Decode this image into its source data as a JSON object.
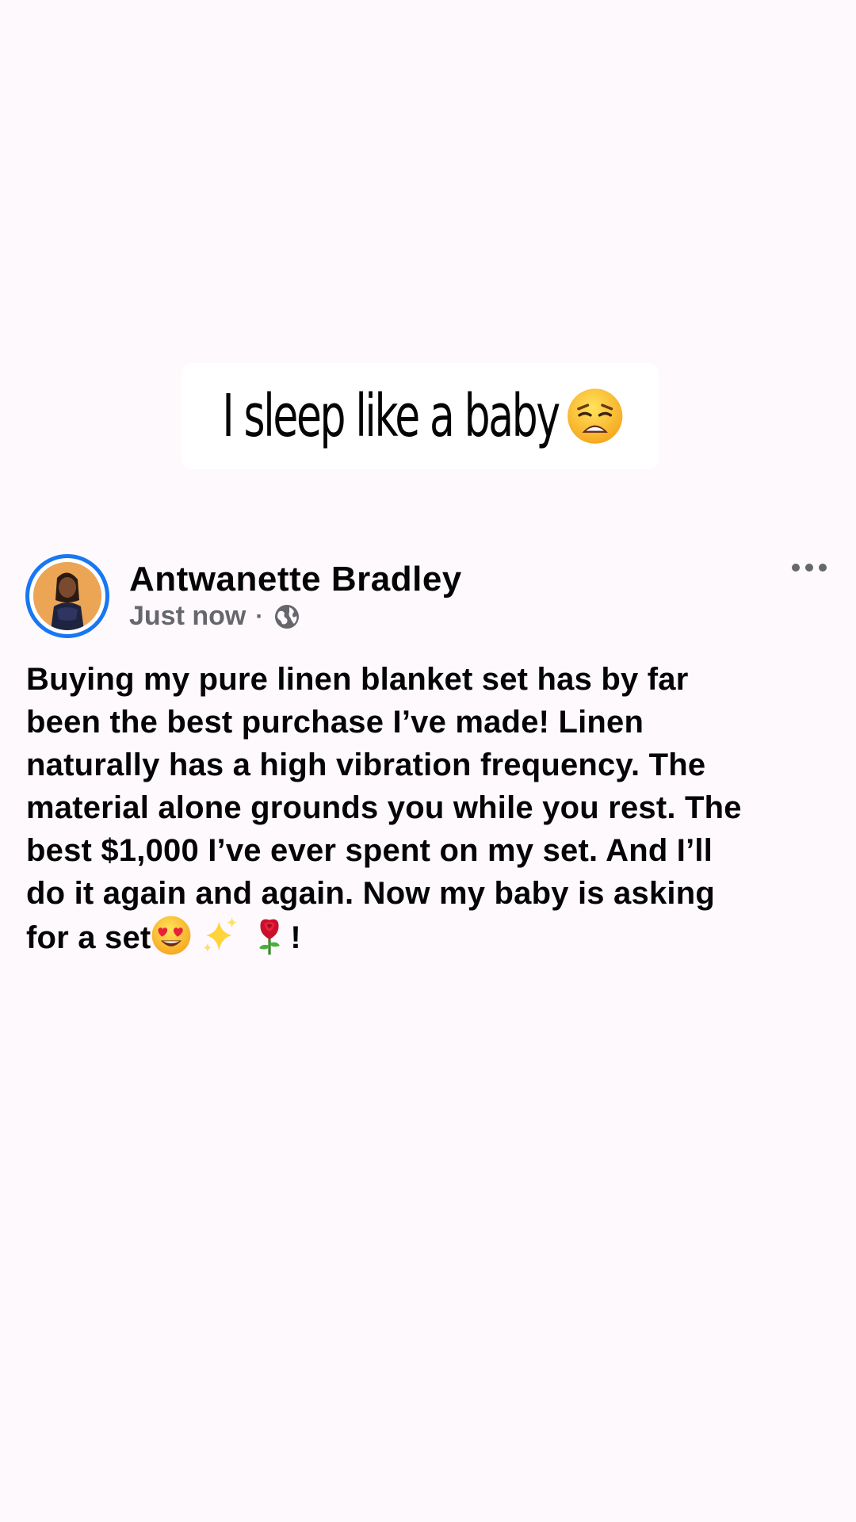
{
  "story": {
    "caption": "I sleep like a baby",
    "caption_emoji": "weary-face-emoji"
  },
  "post": {
    "author": "Antwanette Bradley",
    "timestamp": "Just now",
    "separator": "·",
    "audience_icon": "globe-icon",
    "more_icon": "ellipsis-icon",
    "body_lines": [
      "Buying my pure linen blanket set has by far",
      "been the best purchase I’ve made! Linen",
      "naturally has a high vibration frequency. The",
      "material alone grounds you while you rest. The",
      "best $1,000 I’ve ever spent on my set. And I’ll",
      "do it again and again. Now my baby is asking",
      "for a set"
    ],
    "body_end": "!",
    "body_emojis": [
      "heart-eyes-emoji",
      "sparkles-emoji",
      "rose-emoji"
    ]
  },
  "colors": {
    "background": "#fdf9fd",
    "accent": "#1877f2",
    "secondary_text": "#65676b",
    "primary_text": "#050505"
  }
}
